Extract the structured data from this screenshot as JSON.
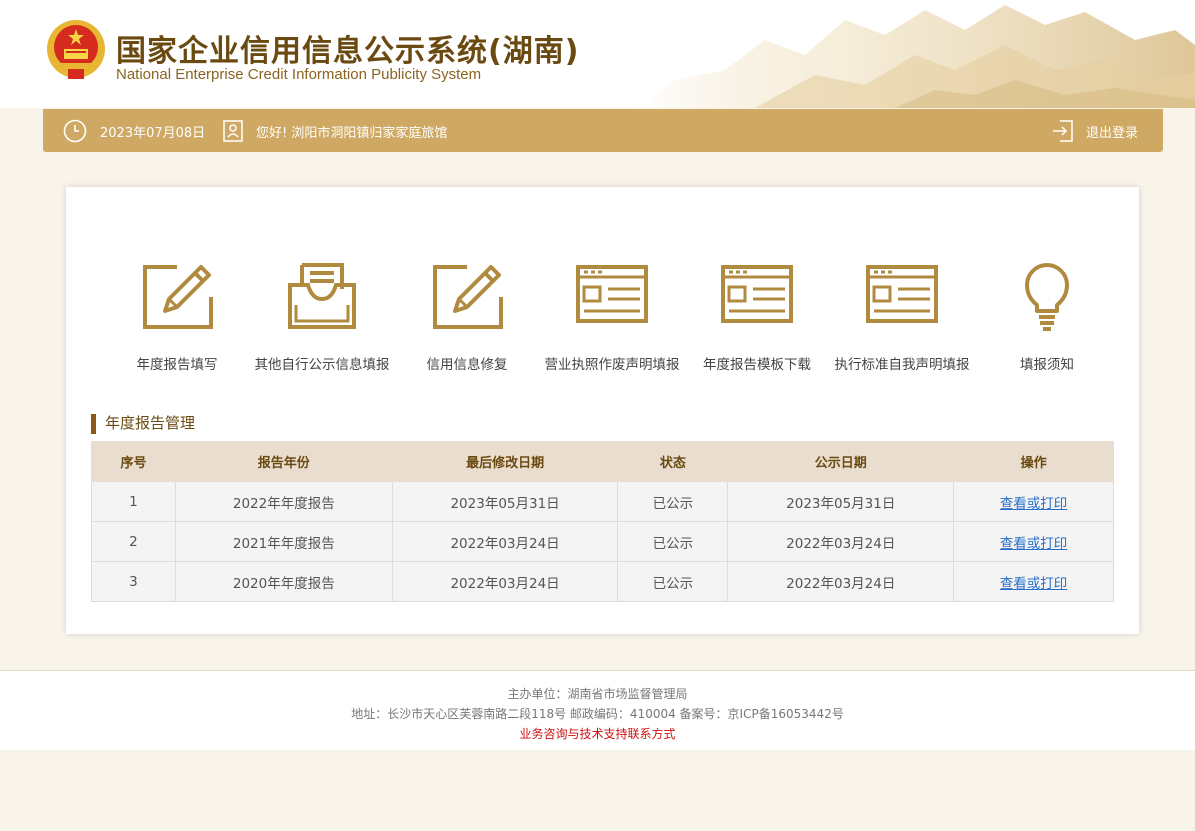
{
  "header": {
    "title_cn": "国家企业信用信息公示系统(湖南)",
    "title_en": "National Enterprise Credit Information Publicity System"
  },
  "topbar": {
    "date": "2023年07月08日",
    "greeting": "您好!  浏阳市洞阳镇归家家庭旅馆",
    "logout": "退出登录"
  },
  "menu": [
    {
      "label": "年度报告填写",
      "icon": "edit-document-icon"
    },
    {
      "label": "其他自行公示信息填报",
      "icon": "inbox-tray-icon"
    },
    {
      "label": "信用信息修复",
      "icon": "edit-document-icon"
    },
    {
      "label": "营业执照作废声明填报",
      "icon": "form-window-icon"
    },
    {
      "label": "年度报告模板下载",
      "icon": "form-window-icon"
    },
    {
      "label": "执行标准自我声明填报",
      "icon": "form-window-icon"
    },
    {
      "label": "填报须知",
      "icon": "lightbulb-icon"
    }
  ],
  "section_title": "年度报告管理",
  "table": {
    "headers": [
      "序号",
      "报告年份",
      "最后修改日期",
      "状态",
      "公示日期",
      "操作"
    ],
    "rows": [
      {
        "no": "1",
        "year": "2022年年度报告",
        "modified": "2023年05月31日",
        "status": "已公示",
        "published": "2023年05月31日",
        "action": "查看或打印"
      },
      {
        "no": "2",
        "year": "2021年年度报告",
        "modified": "2022年03月24日",
        "status": "已公示",
        "published": "2022年03月24日",
        "action": "查看或打印"
      },
      {
        "no": "3",
        "year": "2020年年度报告",
        "modified": "2022年03月24日",
        "status": "已公示",
        "published": "2022年03月24日",
        "action": "查看或打印"
      }
    ]
  },
  "footer": {
    "sponsor": "主办单位：湖南省市场监督管理局",
    "address": "地址：长沙市天心区芙蓉南路二段118号 邮政编码：410004 备案号：京ICP备16053442号",
    "contact": "业务咨询与技术支持联系方式"
  },
  "colors": {
    "accent": "#cfa963",
    "brand_brown": "#6b4a12",
    "icon_gold": "#b08a3e",
    "link": "#2a6fc9",
    "footer_alert": "#cc1111"
  }
}
